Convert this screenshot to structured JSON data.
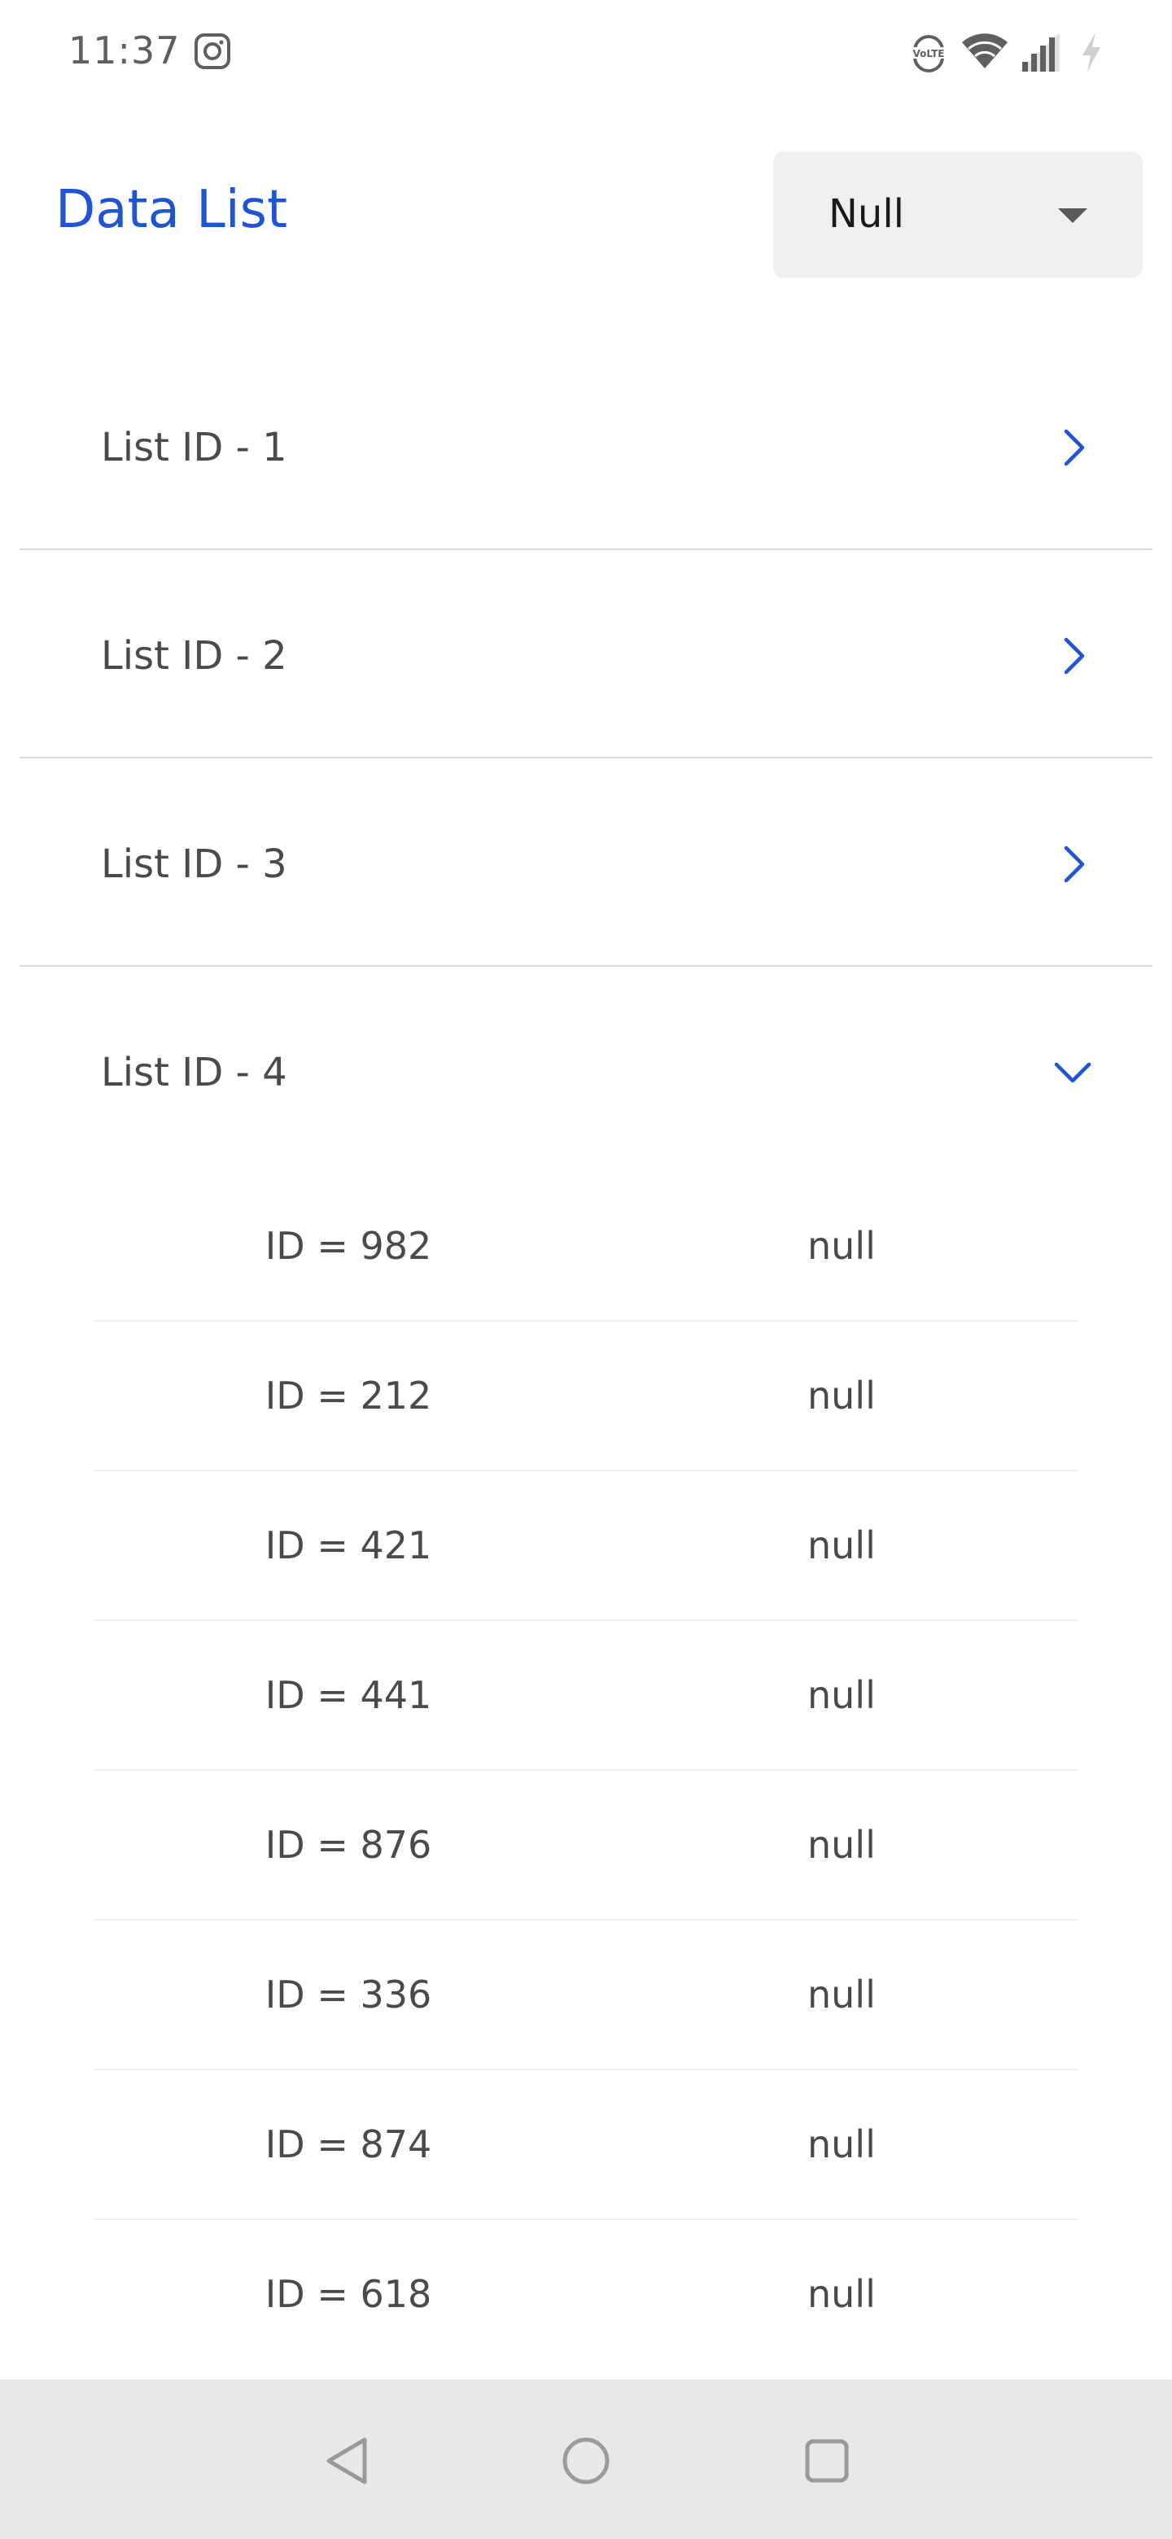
{
  "status_bar": {
    "time": "11:37",
    "icons": [
      "instagram-icon",
      "volte-icon",
      "wifi-icon",
      "signal-icon",
      "charging-icon"
    ]
  },
  "header": {
    "title": "Data List",
    "dropdown": {
      "selected": "Null"
    }
  },
  "colors": {
    "accent": "#1d55d4",
    "text": "#4a4a4a",
    "divider": "#d9d9d9",
    "dropdown_bg": "#efefef",
    "nav_bg": "#e8e8e8"
  },
  "groups": [
    {
      "label": "List ID - 1",
      "expanded": false,
      "chevron": "chevron-right-icon"
    },
    {
      "label": "List ID - 2",
      "expanded": false,
      "chevron": "chevron-right-icon"
    },
    {
      "label": "List ID - 3",
      "expanded": false,
      "chevron": "chevron-right-icon"
    },
    {
      "label": "List ID - 4",
      "expanded": true,
      "chevron": "chevron-down-icon"
    }
  ],
  "expanded_items": [
    {
      "id": "ID = 982",
      "name": "null"
    },
    {
      "id": "ID = 212",
      "name": "null"
    },
    {
      "id": "ID = 421",
      "name": "null"
    },
    {
      "id": "ID = 441",
      "name": "null"
    },
    {
      "id": "ID = 876",
      "name": "null"
    },
    {
      "id": "ID = 336",
      "name": "null"
    },
    {
      "id": "ID = 874",
      "name": "null"
    },
    {
      "id": "ID = 618",
      "name": "null"
    }
  ],
  "nav_bar": {
    "buttons": [
      "back-icon",
      "home-icon",
      "recents-icon"
    ]
  }
}
